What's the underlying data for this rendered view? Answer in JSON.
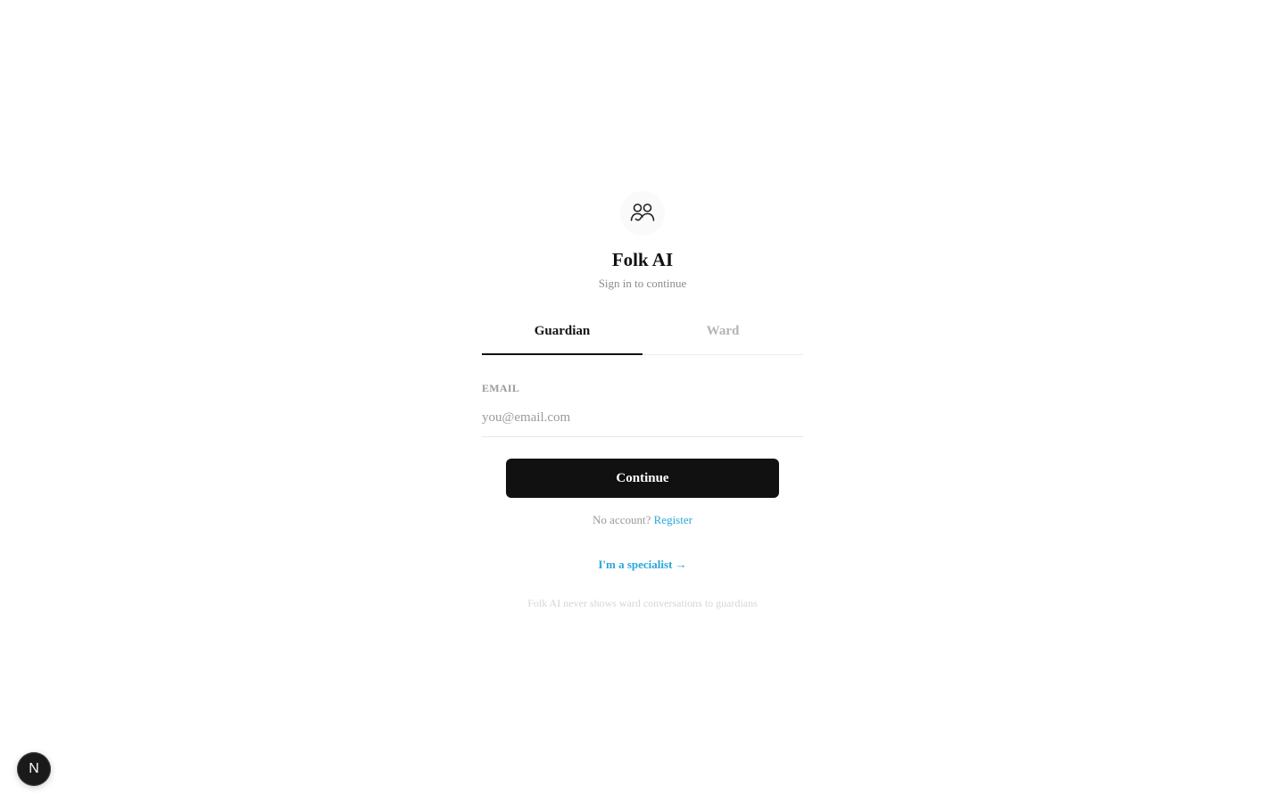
{
  "app": {
    "title": "Folk AI",
    "subtitle": "Sign in to continue",
    "logo_icon": "two-people-icon"
  },
  "tabs": [
    {
      "label": "Guardian",
      "active": true
    },
    {
      "label": "Ward",
      "active": false
    }
  ],
  "form": {
    "email_label": "EMAIL",
    "email_placeholder": "you@email.com",
    "email_value": "",
    "submit_label": "Continue"
  },
  "register": {
    "prompt": "No account?",
    "link_label": "Register"
  },
  "specialist_link": "I'm a specialist →",
  "privacy_note": "Folk AI never shows ward conversations to guardians",
  "dev_badge": {
    "letter": "N",
    "icon": "nextjs-icon"
  },
  "colors": {
    "primary": "#111111",
    "link": "#2aa6dc",
    "muted": "#9a9a9a",
    "background": "#ffffff"
  }
}
